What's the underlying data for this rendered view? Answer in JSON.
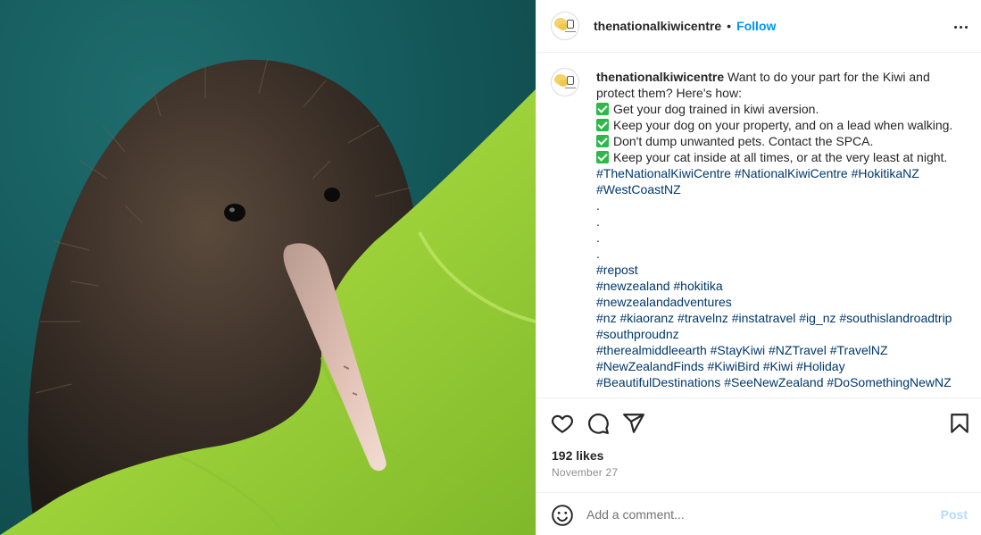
{
  "post": {
    "username": "thenationalkiwicentre",
    "separator": "•",
    "follow_label": "Follow",
    "more_label": "More options",
    "photo_alt": "Kiwi bird wrapped in a green blanket"
  },
  "caption": {
    "username": "thenationalkiwicentre",
    "intro": "Want to do your part for the Kiwi and protect them? Here's how:",
    "checklist": [
      "Get your dog trained in kiwi aversion.",
      "Keep your dog on your property, and on a lead when walking.",
      "Don't dump unwanted pets. Contact the SPCA.",
      "Keep your cat inside at all times, or at the very least at night."
    ],
    "hashtags_1": "#TheNationalKiwiCentre #NationalKiwiCentre #HokitikaNZ #WestCoastNZ",
    "dots": [
      ".",
      ".",
      ".",
      "."
    ],
    "tag_lines": [
      "#repost",
      "#newzealand #hokitika",
      "#newzealandadventures",
      "#nz #kiaoranz #travelnz #instatravel #ig_nz #southislandroadtrip #southproudnz",
      "#therealmiddleearth #StayKiwi #NZTravel #TravelNZ",
      "#NewZealandFinds #KiwiBird #Kiwi #Holiday",
      "#BeautifulDestinations #SeeNewZealand #DoSomethingNewNZ"
    ]
  },
  "actions": {
    "like_icon": "heart-icon",
    "comment_icon": "comment-bubble-icon",
    "share_icon": "paper-plane-icon",
    "save_icon": "bookmark-icon"
  },
  "stats": {
    "likes": "192 likes",
    "date": "November 27"
  },
  "comment": {
    "placeholder": "Add a comment...",
    "post_label": "Post",
    "emoji_icon": "smiley-icon"
  },
  "colors": {
    "link_blue": "#0095f6",
    "hashtag": "#00376b",
    "post_disabled": "#b3dbff",
    "blanket_green": "#9ed23a",
    "check_green": "#2eb84b"
  }
}
